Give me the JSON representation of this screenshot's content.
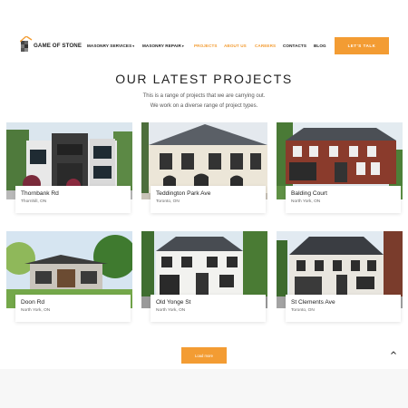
{
  "brand": {
    "name": "GAME OF STONE"
  },
  "nav": {
    "items": [
      {
        "label": "MASONRY SERVICES",
        "caret": "▾"
      },
      {
        "label": "MASONRY REPAIR",
        "caret": "▾"
      },
      {
        "label": "PROJECTS"
      },
      {
        "label": "ABOUT US"
      },
      {
        "label": "CAREERS"
      },
      {
        "label": "CONTACTS"
      },
      {
        "label": "BLOG"
      }
    ],
    "cta_label": "LET'S TALK"
  },
  "section": {
    "title": "OUR LATEST PROJECTS",
    "line1": "This is a range of projects that we are carrying out.",
    "line2": "We work on a diverse range of project types."
  },
  "projects": [
    {
      "name": "Thornbank Rd",
      "location": "Thornhill, ON"
    },
    {
      "name": "Teddington Park Ave",
      "location": "Toronto, ON"
    },
    {
      "name": "Balding Court",
      "location": "North York, ON"
    },
    {
      "name": "Doon Rd",
      "location": "North York, ON"
    },
    {
      "name": "Old Yonge St",
      "location": "North York, ON"
    },
    {
      "name": "St Clements Ave",
      "location": "Toronto, ON"
    }
  ],
  "load_more_label": "Load more",
  "scroll_top_icon": "chevron-up-icon",
  "colors": {
    "accent": "#f39c33",
    "active_nav": "#f39c33"
  }
}
